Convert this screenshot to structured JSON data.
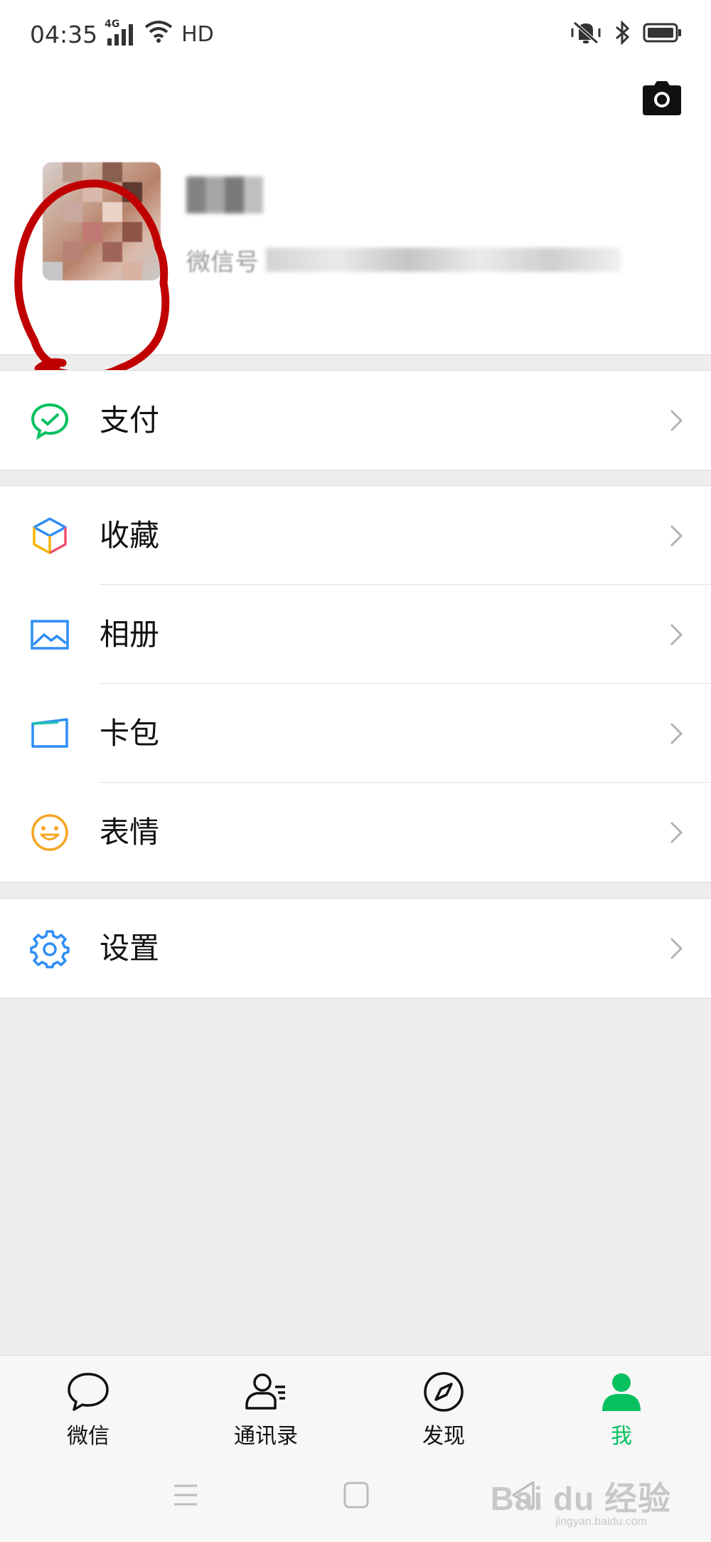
{
  "status_bar": {
    "time": "04:35",
    "network": "4G",
    "hd": "HD"
  },
  "profile": {
    "wechat_id_label": "微信号"
  },
  "menu_groups": [
    {
      "items": [
        {
          "label": "支付",
          "icon": "pay-icon"
        }
      ]
    },
    {
      "items": [
        {
          "label": "收藏",
          "icon": "favorites-cube-icon"
        },
        {
          "label": "相册",
          "icon": "album-picture-icon"
        },
        {
          "label": "卡包",
          "icon": "card-wallet-icon"
        },
        {
          "label": "表情",
          "icon": "sticker-smile-icon"
        }
      ]
    },
    {
      "items": [
        {
          "label": "设置",
          "icon": "settings-gear-icon"
        }
      ]
    }
  ],
  "tabbar": {
    "tabs": [
      {
        "label": "微信",
        "icon": "chat-bubble-icon",
        "active": false
      },
      {
        "label": "通讯录",
        "icon": "contacts-icon",
        "active": false
      },
      {
        "label": "发现",
        "icon": "compass-icon",
        "active": false
      },
      {
        "label": "我",
        "icon": "person-icon",
        "active": true
      }
    ]
  },
  "watermark": {
    "brand": "Bai du 经验",
    "url": "jingyan.baidu.com"
  },
  "colors": {
    "accent": "#07c160",
    "annotation_circle": "#c00000",
    "background": "#ededed"
  }
}
